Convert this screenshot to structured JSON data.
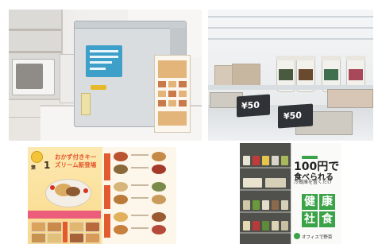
{
  "panels": {
    "fridge_interior": {
      "price_tags": [
        "¥50",
        "¥50"
      ]
    },
    "menu_leaflet": {
      "issue_label": "第",
      "issue_number": "1",
      "headline": "おかず付きキーズリーム新登場",
      "colors": {
        "accent": "#e4572e",
        "background": "#fbe8b3"
      }
    },
    "signage_book": {
      "price_line1": "100円で",
      "price_line2": "食べられる",
      "sub_line1": "冷蔵庫を置くだけ",
      "tiles": [
        "健",
        "康",
        "社",
        "食"
      ],
      "brand": "オフィスで野菜",
      "colors": {
        "tile": "#3aa247"
      }
    }
  }
}
